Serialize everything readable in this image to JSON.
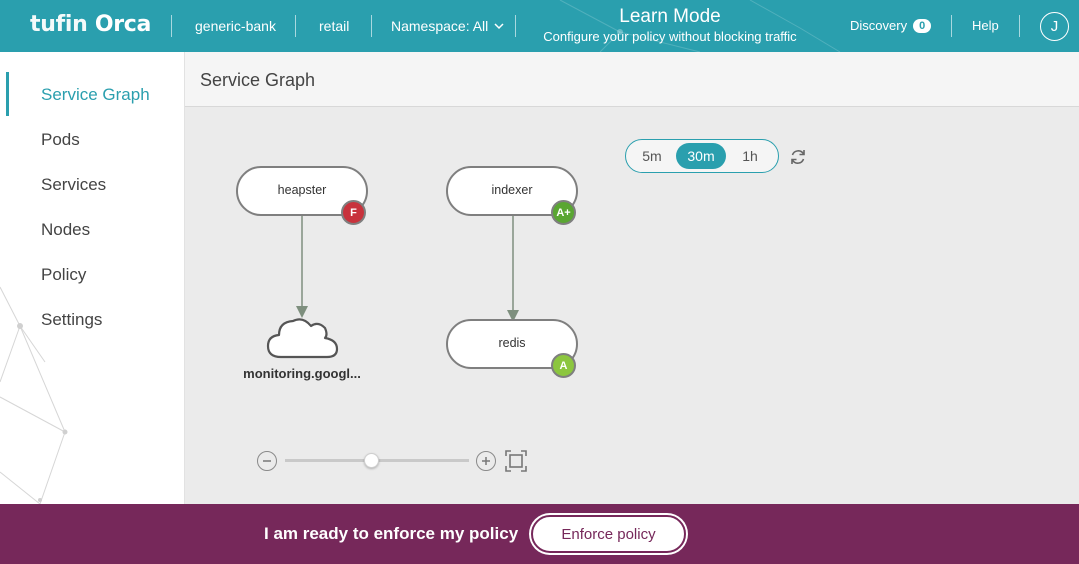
{
  "topbar": {
    "logo_part1": "tufin",
    "logo_part2": "Orca",
    "account": "generic-bank",
    "cluster": "retail",
    "namespace_label": "Namespace: All",
    "mode_title": "Learn Mode",
    "mode_subtitle": "Configure your policy without blocking traffic",
    "discovery_label": "Discovery",
    "discovery_count": "0",
    "help_label": "Help",
    "user_initial": "J",
    "bar_color": "#2a9fae"
  },
  "sidebar": {
    "items": [
      {
        "label": "Service Graph",
        "active": true
      },
      {
        "label": "Pods",
        "active": false
      },
      {
        "label": "Services",
        "active": false
      },
      {
        "label": "Nodes",
        "active": false
      },
      {
        "label": "Policy",
        "active": false
      },
      {
        "label": "Settings",
        "active": false
      }
    ]
  },
  "main": {
    "title": "Service Graph",
    "time_ranges": [
      "5m",
      "30m",
      "1h"
    ],
    "selected_time_range": "30m",
    "graph": {
      "nodes": [
        {
          "name": "heapster",
          "grade": "F",
          "grade_color": "#c8323c"
        },
        {
          "name": "indexer",
          "grade": "A+",
          "grade_color": "#5aa632"
        },
        {
          "name": "redis",
          "grade": "A",
          "grade_color": "#8cc63f"
        }
      ],
      "external": {
        "name": "monitoring.googl...",
        "icon": "cloud-icon"
      },
      "edges": [
        {
          "from": "heapster",
          "to": "monitoring.googl..."
        },
        {
          "from": "indexer",
          "to": "redis"
        }
      ]
    },
    "zoom": {
      "level": 0.47
    }
  },
  "bottombar": {
    "message": "I am ready to enforce my policy",
    "enforce_label": "Enforce policy",
    "bar_color": "#76285a"
  }
}
